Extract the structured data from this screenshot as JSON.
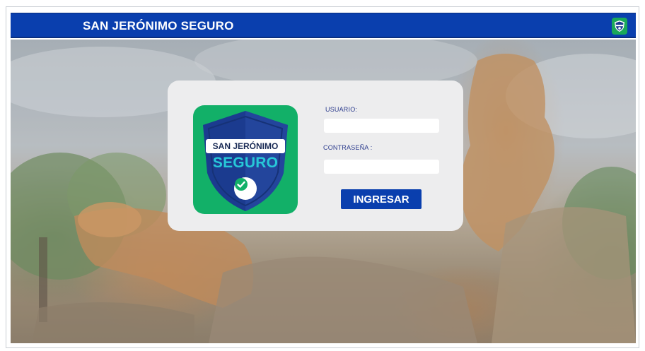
{
  "header": {
    "title": "SAN JERÓNIMO SEGURO",
    "logo_icon": "shield-logo-icon"
  },
  "login": {
    "logo": {
      "banner_text": "SAN JERÓNIMO",
      "word_text": "SEGURO",
      "icon": "check-icon"
    },
    "user_label": "USUARIO:",
    "user_value": "",
    "password_label": "CONTRASEÑA :",
    "password_value": "",
    "submit_label": "INGRESAR"
  },
  "colors": {
    "primary": "#0a3fae",
    "logo_green": "#12b068",
    "card_bg": "#ededee",
    "label_text": "#2a3a8c"
  }
}
